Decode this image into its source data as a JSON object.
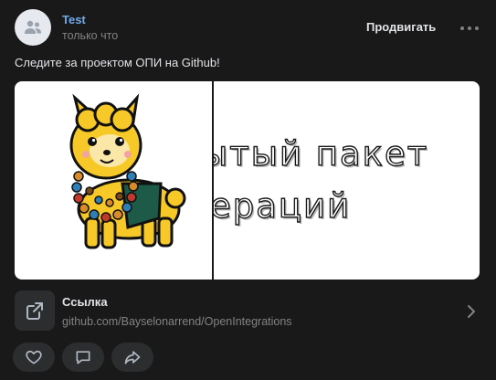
{
  "post": {
    "author": "Test",
    "time": "только что",
    "promote_label": "Продвигать",
    "text": "Следите за проектом ОПИ на Github!"
  },
  "gallery": {
    "line1": "ытый пакет",
    "line2": "ераций"
  },
  "link": {
    "title": "Ссылка",
    "url": "github.com/Bayselonarrend/OpenIntegrations"
  },
  "icons": {
    "avatar": "users-icon",
    "more": "more-horizontal-icon",
    "link": "external-link-icon",
    "chevron": "chevron-right-icon",
    "like": "heart-icon",
    "comment": "comment-icon",
    "share": "share-icon"
  },
  "colors": {
    "background": "#19191a",
    "accent": "#71aaeb",
    "secondary_text": "#828282",
    "button_bg": "#2c2d2e"
  }
}
